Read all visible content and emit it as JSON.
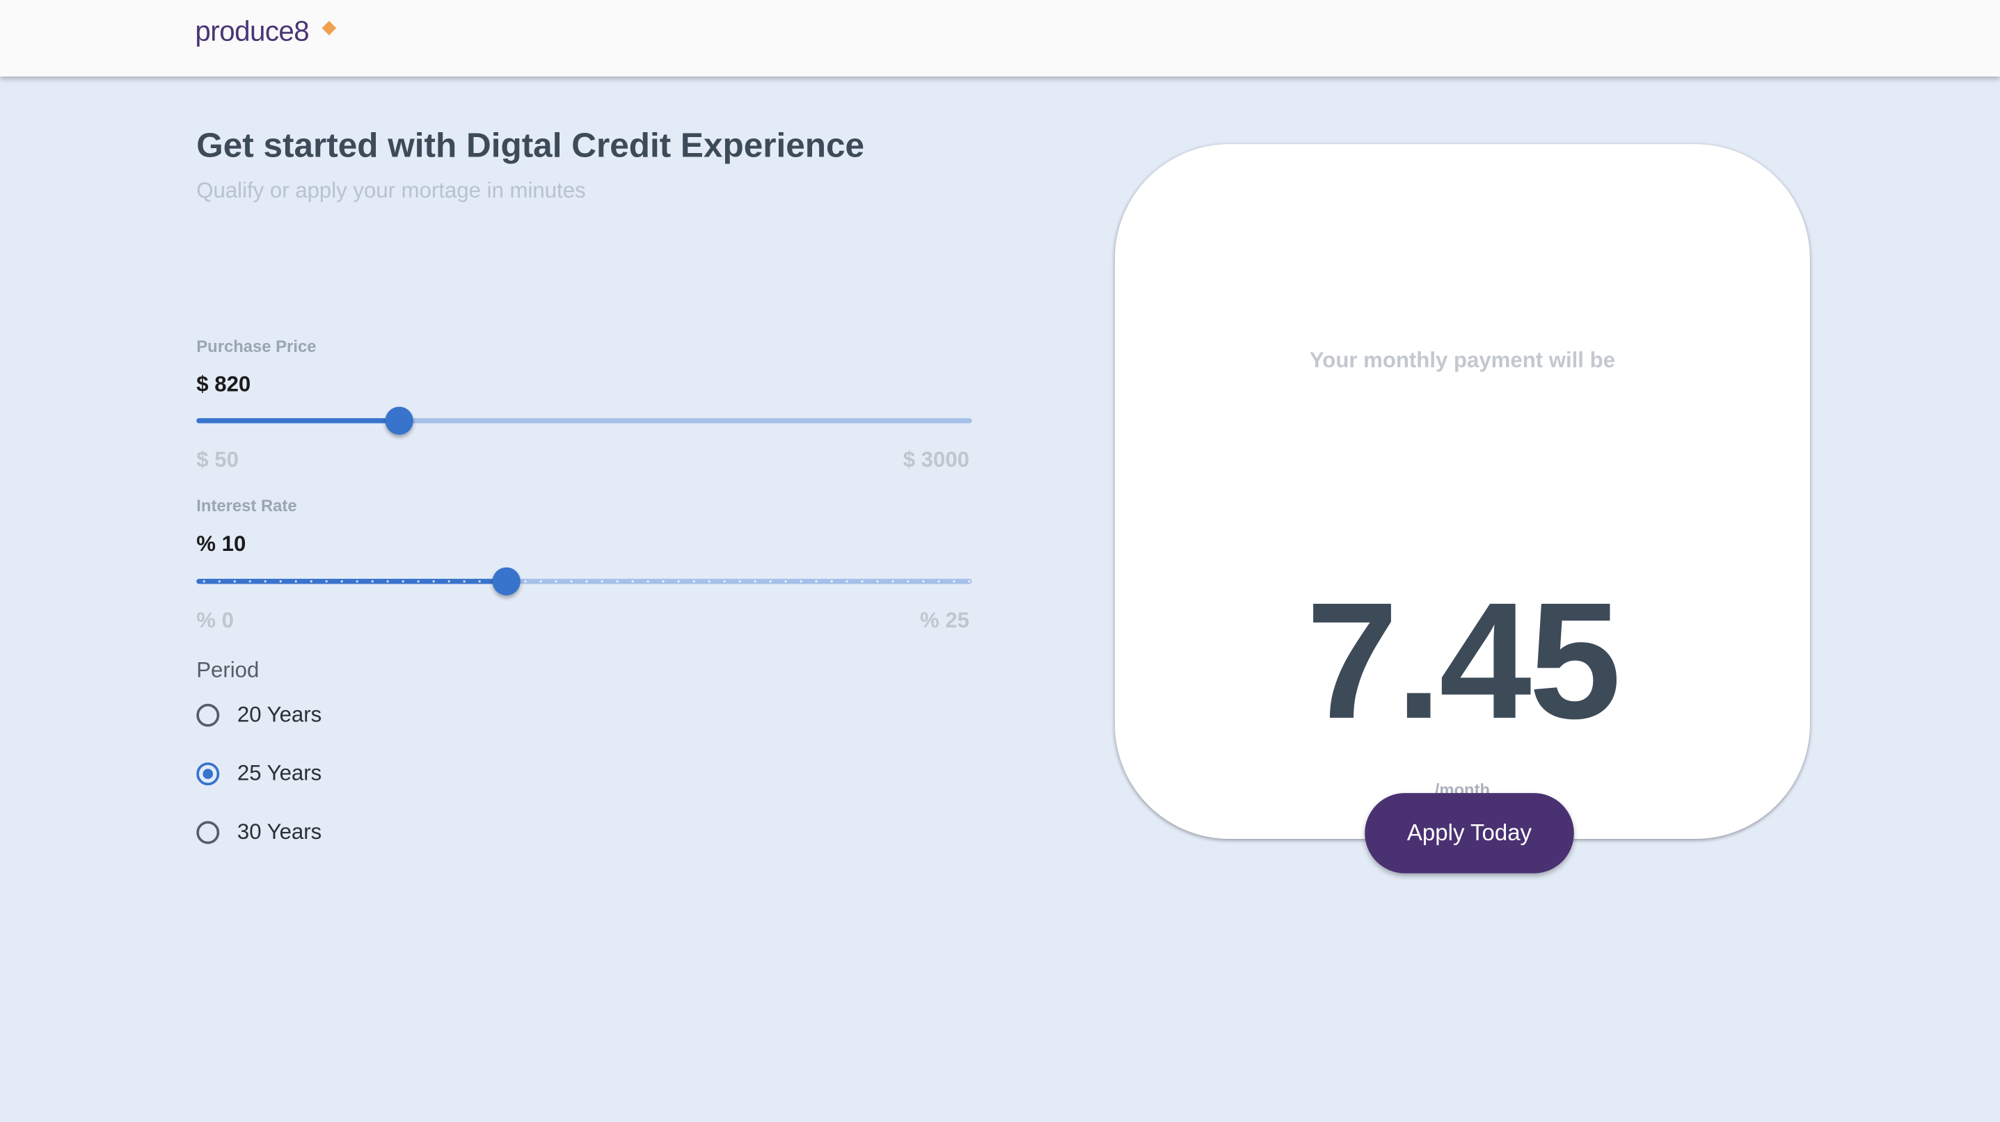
{
  "header": {
    "logo": "produce8"
  },
  "intro": {
    "title": "Get started with Digtal Credit Experience",
    "subtitle": "Qualify or apply your mortage in minutes"
  },
  "purchase_price": {
    "label": "Purchase Price",
    "value_text": "$ 820",
    "value": 820,
    "min": 50,
    "max": 3000,
    "min_label": "$ 50",
    "max_label": "$ 3000"
  },
  "interest_rate": {
    "label": "Interest Rate",
    "value_text": "% 10",
    "value": 10,
    "min": 0,
    "max": 25,
    "min_label": "% 0",
    "max_label": "% 25"
  },
  "period": {
    "label": "Period",
    "options": [
      {
        "label": "20 Years",
        "selected": false
      },
      {
        "label": "25 Years",
        "selected": true
      },
      {
        "label": "30 Years",
        "selected": false
      }
    ]
  },
  "result": {
    "heading": "Your monthly payment will be",
    "amount": "7.45",
    "unit": "/month",
    "button": "Apply Today"
  },
  "colors": {
    "accent": "#3873cc",
    "brand": "#4a3172",
    "background": "#e3ebf7"
  }
}
